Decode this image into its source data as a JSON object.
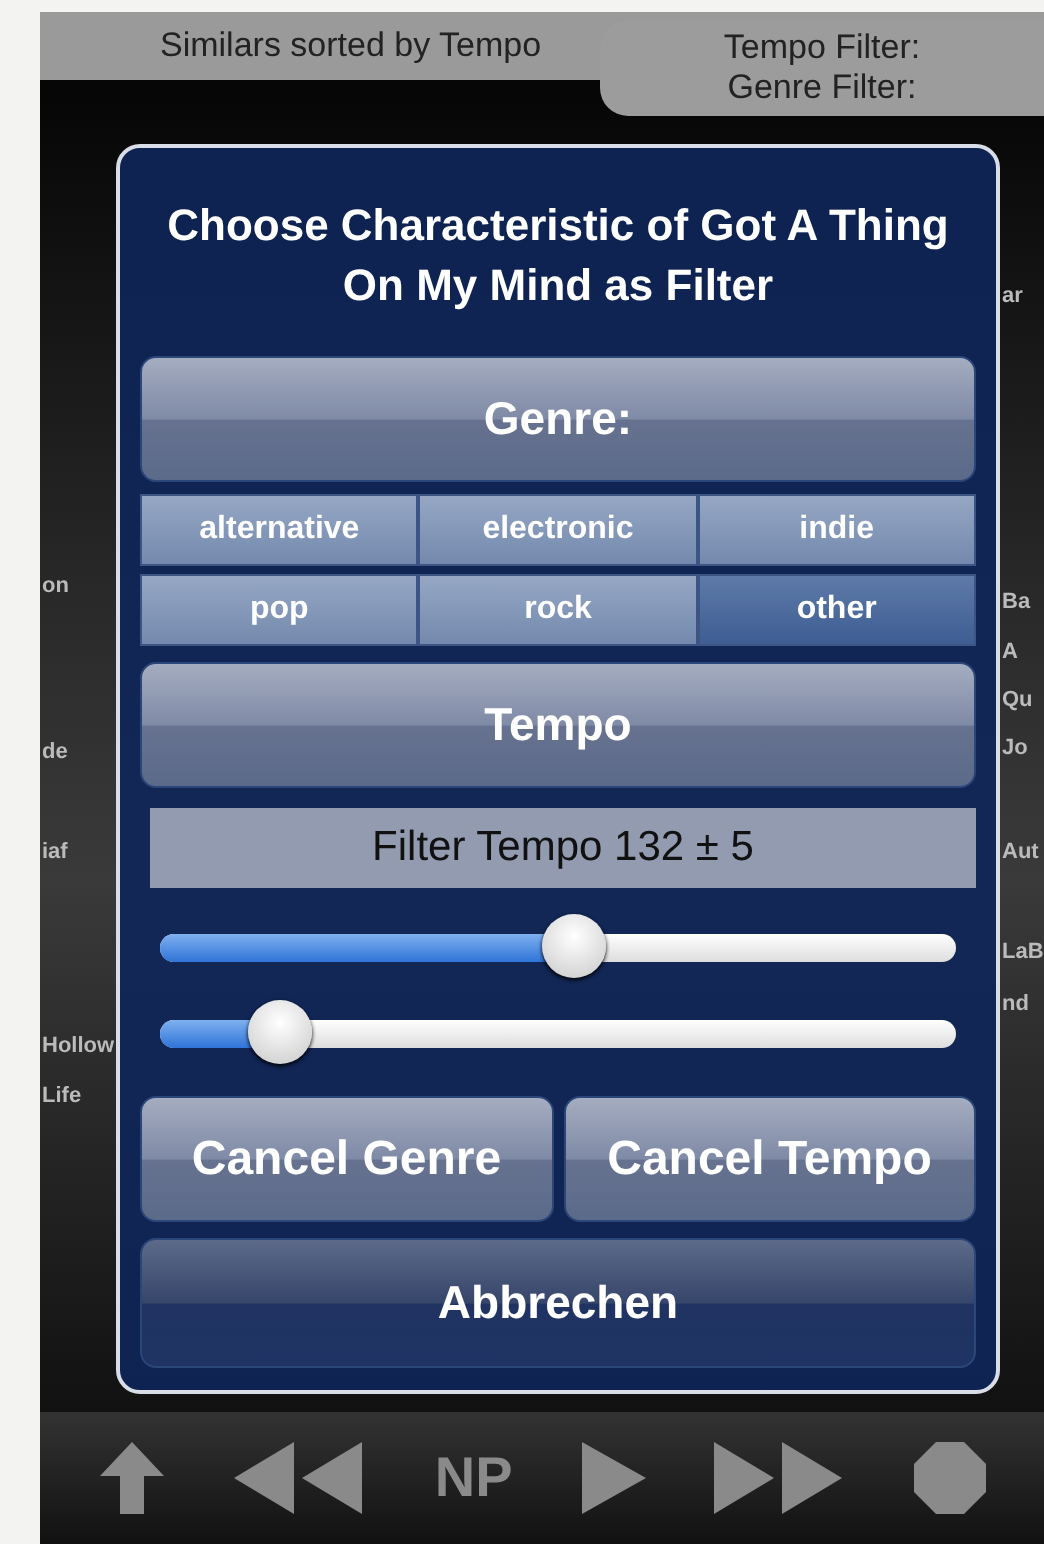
{
  "header": {
    "title": "Similars sorted by Tempo",
    "filters": [
      "Tempo Filter:",
      "Genre Filter:"
    ]
  },
  "background": {
    "left_labels": [
      "on",
      "de",
      "iaf",
      "Hollow",
      "Life"
    ],
    "right_labels": [
      "ar",
      "Ba",
      "A",
      "Qu",
      "Jo",
      "Aut",
      "LaB",
      "nd"
    ]
  },
  "dialog": {
    "title": "Choose Characteristic of Got A Thing On My Mind as Filter",
    "genre_button": "Genre:",
    "genres": [
      {
        "label": "alternative",
        "selected": false
      },
      {
        "label": "electronic",
        "selected": false
      },
      {
        "label": "indie",
        "selected": false
      },
      {
        "label": "pop",
        "selected": false
      },
      {
        "label": "rock",
        "selected": false
      },
      {
        "label": "other",
        "selected": true
      }
    ],
    "tempo_button": "Tempo",
    "tempo_label": "Filter Tempo 132 ± 5",
    "sliders": [
      {
        "level": 0.52
      },
      {
        "level": 0.15
      }
    ],
    "buttons": [
      "Cancel Genre",
      "Cancel Tempo"
    ],
    "cancel": "Abbrechen"
  },
  "toolbar": [
    {
      "kind": "up"
    },
    {
      "kind": "rewind"
    },
    {
      "kind": "text",
      "label": "NP"
    },
    {
      "kind": "play"
    },
    {
      "kind": "forward"
    },
    {
      "kind": "stop"
    }
  ]
}
